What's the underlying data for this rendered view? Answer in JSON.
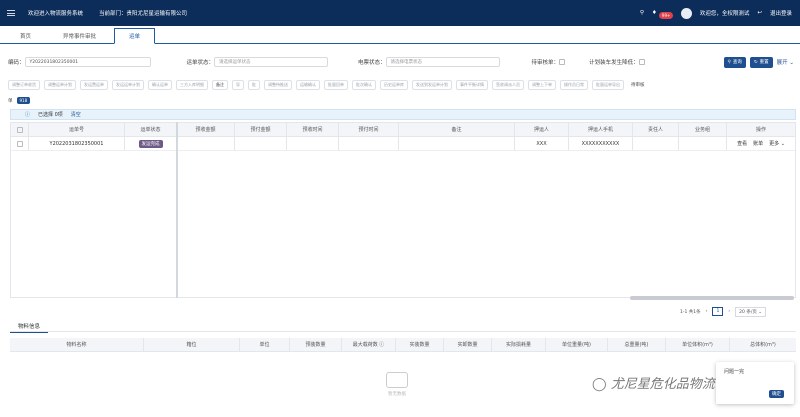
{
  "topbar": {
    "system_name": "欢迎进入物流服务系统",
    "dept": "当前部门：贵阳尤尼星运输有限公司",
    "notice_count": "99+",
    "welcome": "欢迎您，全权限测试",
    "logout": "退出登录"
  },
  "tabs": [
    {
      "label": "首页"
    },
    {
      "label": "异常事件审批"
    },
    {
      "label": "运单"
    }
  ],
  "filters": {
    "code_label": "编码：",
    "code_value": "Y2022031802350001",
    "order_status_label": "运单状态：",
    "order_status_placeholder": "请选择运单状态",
    "e_status_label": "电票状态：",
    "e_status_placeholder": "请选择电票状态",
    "pending_label": "待审核单：",
    "plan_label": "计划装车发生降低：",
    "search_btn": "查询",
    "reset_btn": "重置",
    "expand": "展开"
  },
  "toolbar": [
    "调整订单收货",
    "调整运单计划",
    "发运费运单",
    "发运运单计划",
    "确认运单",
    "三方入库明细",
    "备注",
    "导",
    "批",
    "调整待推送",
    "运输确认",
    "批量回单",
    "批次确认",
    "历史运单库",
    "待",
    "发送到发运单计划",
    "事件平衡详情",
    "签收调派人员",
    "调整上下单",
    "操作员日常",
    "批量运单导出",
    "待审核"
  ],
  "count_row": {
    "label": "单",
    "count": "918"
  },
  "selection": {
    "selected": "已选择 0项",
    "clear": "清空"
  },
  "table": {
    "headers": [
      "运单号",
      "运单状态",
      "预收金额",
      "预付金额",
      "预收时间",
      "预付时间",
      "备注",
      "押运人",
      "押运人手机",
      "责任人",
      "业务组",
      "操作"
    ],
    "rows": [
      {
        "order_no": "Y2022031802350001",
        "status": "发运完成",
        "escort": "XXX",
        "escort_phone": "XXXXXXXXXXX",
        "op_view": "查看",
        "op_account": "账单",
        "op_more": "更多"
      }
    ]
  },
  "pager": {
    "total": "1-1 共1条",
    "page": "1",
    "size": "20 条/页"
  },
  "material": {
    "title": "物料信息",
    "headers": [
      "物料名称",
      "箱位",
      "单位",
      "预装数量",
      "最大载荷数",
      "实装数量",
      "实卸数量",
      "实际损耗量",
      "单位重量(吨)",
      "总重量(吨)",
      "单位体积(m³)",
      "总体积(m³)"
    ],
    "empty_text": "暂无数据"
  },
  "dialog": {
    "message": "问题一完",
    "ok": "确定"
  },
  "watermark": "尤尼星危化品物流"
}
